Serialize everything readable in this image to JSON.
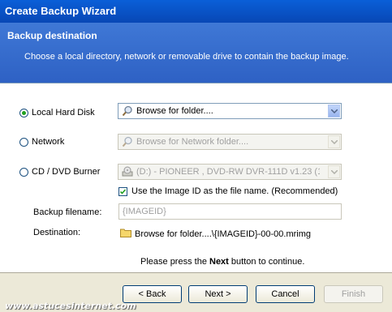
{
  "window": {
    "title": "Create Backup Wizard"
  },
  "header": {
    "title": "Backup destination",
    "description": "Choose a local directory, network  or removable drive to contain the backup image."
  },
  "options": {
    "local": {
      "label": "Local Hard Disk",
      "selected": true,
      "value": "Browse for folder...."
    },
    "network": {
      "label": "Network",
      "selected": false,
      "value": "Browse for Network folder...."
    },
    "cd": {
      "label": "CD / DVD Burner",
      "selected": false,
      "value": "(D:) - PIONEER , DVD-RW  DVR-111D v1.23 (1:0"
    }
  },
  "use_image_id": {
    "label": "Use the Image ID as the file name.  (Recommended)",
    "checked": true
  },
  "backup_filename": {
    "label": "Backup filename:",
    "value": "{IMAGEID}"
  },
  "destination": {
    "label": "Destination:",
    "value": "Browse for folder....\\{IMAGEID}-00-00.mrimg"
  },
  "instruction": {
    "before": "Please press the ",
    "bold": "Next",
    "after": " button to continue."
  },
  "buttons": {
    "back": "< Back",
    "next": "Next >",
    "cancel": "Cancel",
    "finish": "Finish"
  },
  "watermark": "www.astucesinternet.com",
  "icons": {
    "browse": "magnifier-icon",
    "cd": "cd-drive-icon",
    "folder": "folder-icon",
    "dropdown": "chevron-down-icon"
  }
}
